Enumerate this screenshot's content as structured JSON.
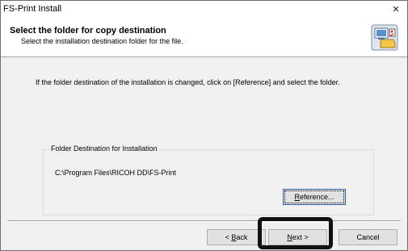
{
  "window": {
    "title": "FS-Print Install",
    "close_glyph": "×"
  },
  "header": {
    "title": "Select the folder for copy destination",
    "subtitle": "Select the installation destination folder for the file.",
    "icon": "installer-folder-icon"
  },
  "body": {
    "instruction": "If the folder destination of the installation is changed, click on [Reference] and select the folder."
  },
  "folder_group": {
    "label": "Folder Destination for Installation",
    "path": "C:\\Program Files\\RICOH DD\\FS-Print",
    "reference_button": {
      "accel": "R",
      "rest": "eference..."
    }
  },
  "buttons": {
    "back": {
      "prefix": "< ",
      "accel": "B",
      "rest": "ack"
    },
    "next": {
      "accel": "N",
      "rest": "ext >"
    },
    "cancel": "Cancel"
  },
  "colors": {
    "window_bg": "#f0f0f0",
    "header_bg": "#ffffff",
    "focus_border": "#2f5fa8",
    "highlight_box": "#111111"
  }
}
